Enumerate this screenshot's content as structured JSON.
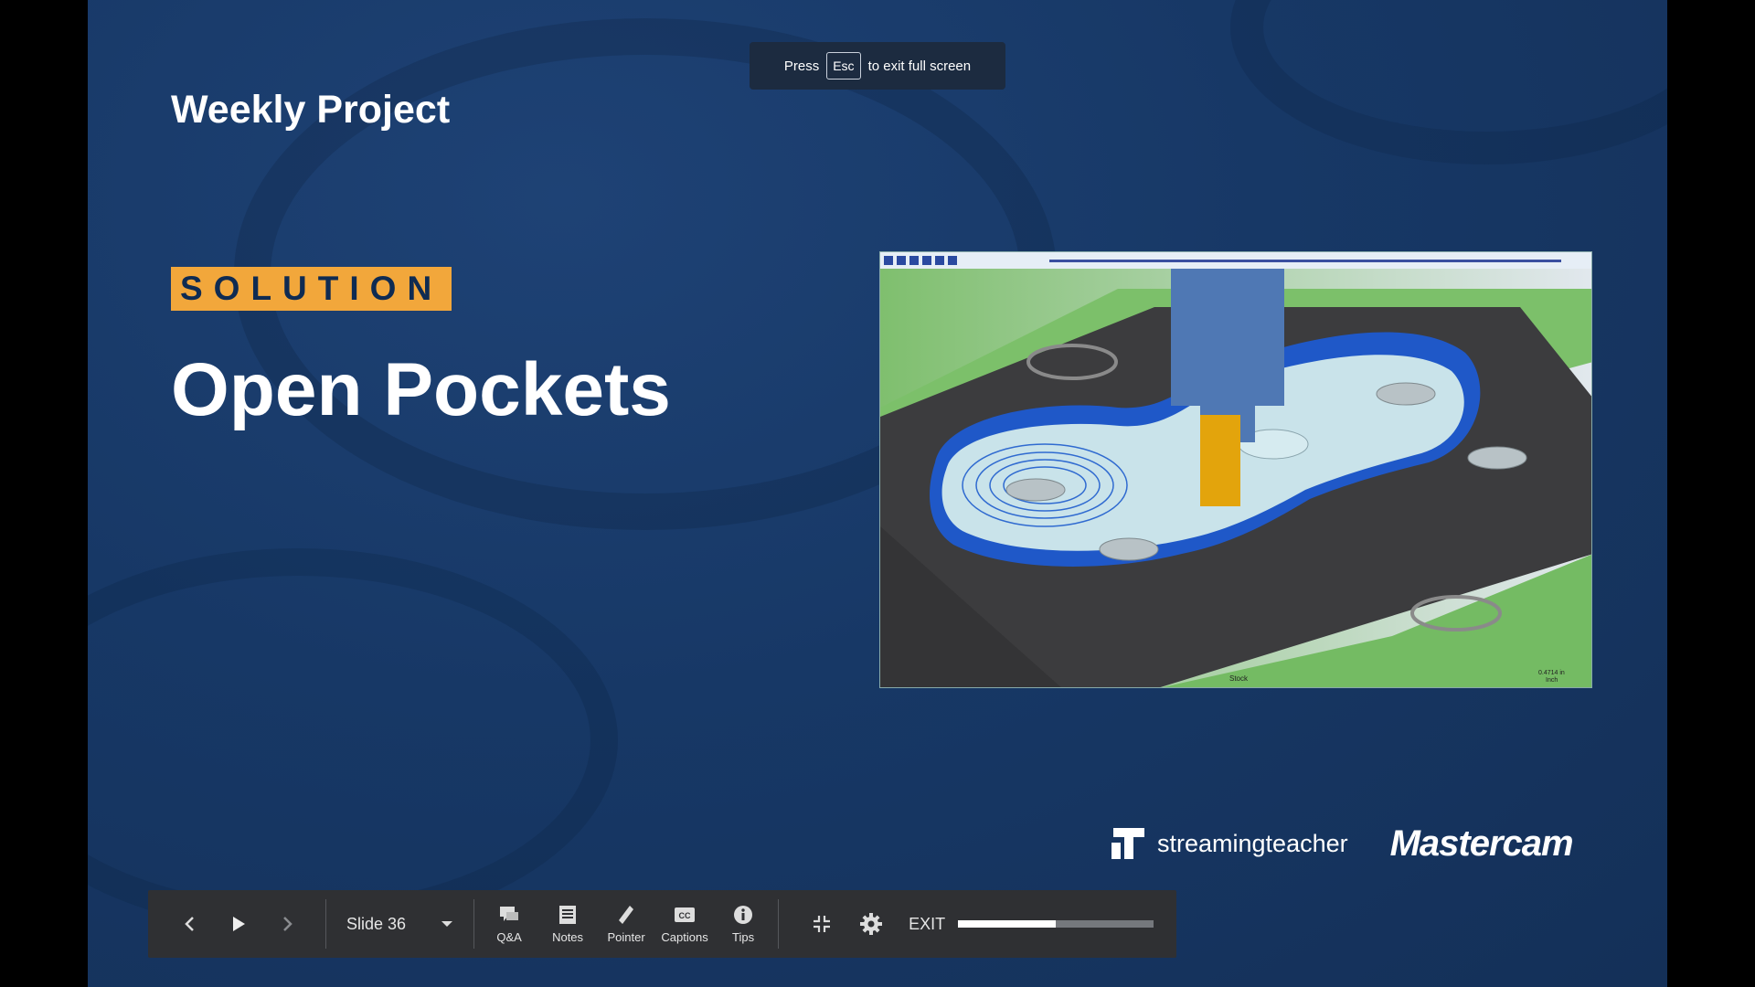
{
  "esc_hint": {
    "before": "Press",
    "key": "Esc",
    "after": "to exit full screen"
  },
  "slide": {
    "heading": "Weekly Project",
    "badge": "SOLUTION",
    "title": "Open Pockets"
  },
  "simulation": {
    "stock_label": "Stock",
    "scale_label": "0.4714 in",
    "unit_label": "Inch"
  },
  "logos": {
    "streamingteacher": "streamingteacher",
    "mastercam": "Mastercam"
  },
  "toolbar": {
    "slide_label": "Slide 36",
    "tools": [
      {
        "label": "Q&A",
        "icon": "chat-icon"
      },
      {
        "label": "Notes",
        "icon": "notes-icon"
      },
      {
        "label": "Pointer",
        "icon": "pointer-icon"
      },
      {
        "label": "Captions",
        "icon": "captions-icon"
      },
      {
        "label": "Tips",
        "icon": "info-icon"
      }
    ],
    "exit_label": "EXIT",
    "progress": 0.5
  }
}
